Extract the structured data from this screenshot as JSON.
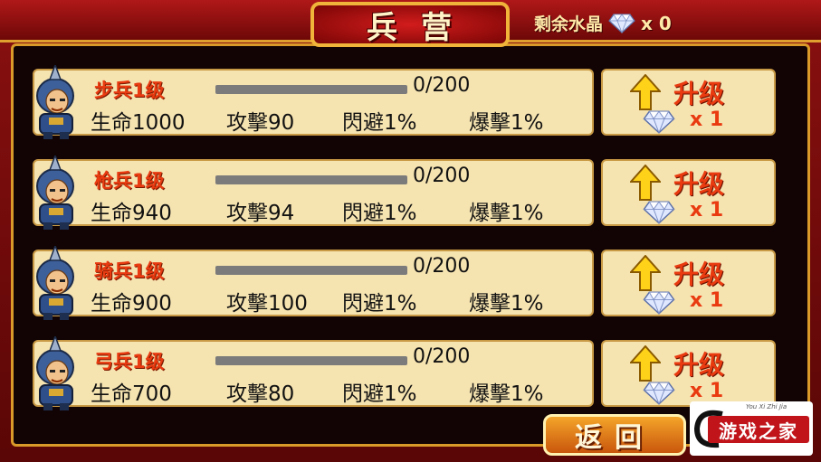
{
  "title": "兵营",
  "header": {
    "crystal_label": "剩余水晶",
    "crystal_count": "x 0"
  },
  "units": [
    {
      "name": "步兵1级",
      "progress_text": "0/200",
      "progress_fraction": 0,
      "hp": "生命1000",
      "attack": "攻擊90",
      "dodge": "閃避1%",
      "crit": "爆擊1%",
      "upgrade_label": "升级",
      "upgrade_cost": "x 1"
    },
    {
      "name": "枪兵1级",
      "progress_text": "0/200",
      "progress_fraction": 0,
      "hp": "生命940",
      "attack": "攻擊94",
      "dodge": "閃避1%",
      "crit": "爆擊1%",
      "upgrade_label": "升级",
      "upgrade_cost": "x 1"
    },
    {
      "name": "骑兵1级",
      "progress_text": "0/200",
      "progress_fraction": 0,
      "hp": "生命900",
      "attack": "攻擊100",
      "dodge": "閃避1%",
      "crit": "爆擊1%",
      "upgrade_label": "升级",
      "upgrade_cost": "x 1"
    },
    {
      "name": "弓兵1级",
      "progress_text": "0/200",
      "progress_fraction": 0,
      "hp": "生命700",
      "attack": "攻擊80",
      "dodge": "閃避1%",
      "crit": "爆擊1%",
      "upgrade_label": "升级",
      "upgrade_cost": "x 1"
    }
  ],
  "back_label": "返回",
  "watermark": {
    "logo_text": "游戏之家",
    "small_text": "You Xi Zhi Jia"
  },
  "icons": {
    "crystal": "diamond-icon",
    "upgrade": "up-arrow-icon"
  },
  "colors": {
    "accent_red": "#e93a10",
    "panel": "#f5e3b0",
    "gold_border": "#d99a2a"
  }
}
